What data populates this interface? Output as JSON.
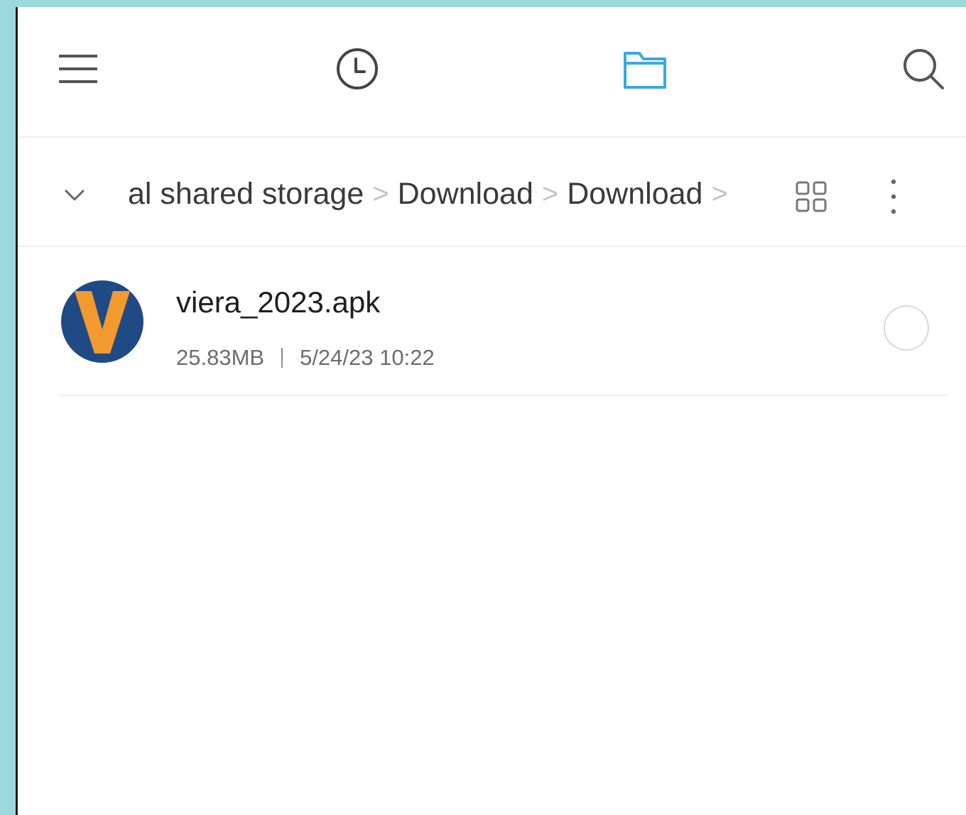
{
  "nav": {
    "icons": [
      "menu-icon",
      "clock-icon",
      "folder-icon",
      "search-icon"
    ],
    "active_color": "#3aa9e0"
  },
  "breadcrumb": {
    "items": [
      "al shared storage",
      "Download",
      "Download"
    ],
    "separator": ">"
  },
  "files": [
    {
      "name": "viera_2023.apk",
      "size": "25.83MB",
      "date": "5/24/23 10:22",
      "icon": "viera-app-icon",
      "icon_colors": {
        "background": "#1f4a86",
        "letter": "#f29a2e"
      },
      "selected": false
    }
  ],
  "colors": {
    "frame": "#9ed8dc",
    "divider": "#eeeeee"
  }
}
